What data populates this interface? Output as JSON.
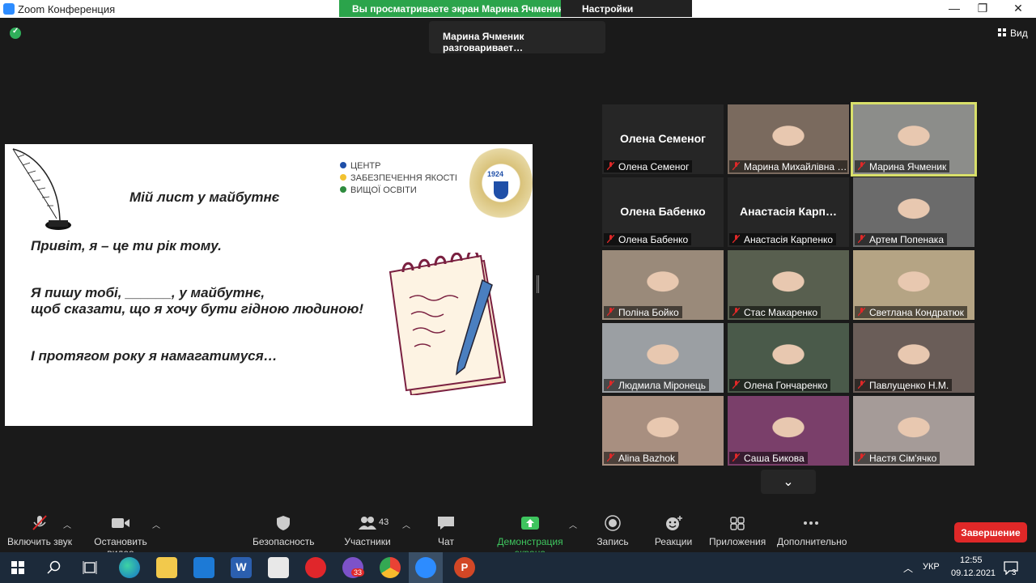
{
  "window": {
    "app_title": "Zoom Конференция",
    "share_banner": "Вы просматриваете экран Марина Ячменик",
    "view_options": "Настройки просмотра"
  },
  "stage": {
    "speaker_chip": "Марина Ячменик разговаривает…",
    "view_button": "Вид"
  },
  "slide": {
    "title": "Мій лист у майбутнє",
    "center_lines": [
      "ЦЕНТР",
      "ЗАБЕЗПЕЧЕННЯ ЯКОСТІ",
      "ВИЩОЇ ОСВІТИ"
    ],
    "line1": "Привіт, я – це ти рік тому.",
    "line2": "Я пишу тобі, ______, у майбутнє,",
    "line3": "щоб сказати, що я хочу бути гідною людиною!",
    "line4": "І протягом року я намагатимуся…",
    "seal_year": "1924",
    "center_dot_colors": [
      "#1f4fa8",
      "#f2c230",
      "#2e8b3e"
    ]
  },
  "participants": [
    {
      "name": "Олена Семеног",
      "big_name": "Олена Семеног",
      "video": false
    },
    {
      "name": "Марина Михайлівна …",
      "big_name": "",
      "video": true,
      "bg": "#7a6a5e"
    },
    {
      "name": "Марина Ячменик",
      "big_name": "",
      "video": true,
      "bg": "#8c8d8a",
      "active": true
    },
    {
      "name": "Олена Бабенко",
      "big_name": "Олена Бабенко",
      "video": false
    },
    {
      "name": "Анастасія Карпенко",
      "big_name": "Анастасія Карп…",
      "video": false
    },
    {
      "name": "Артем Попенака",
      "big_name": "",
      "video": true,
      "bg": "#6b6b6b"
    },
    {
      "name": "Поліна Бойко",
      "big_name": "",
      "video": true,
      "bg": "#9a8a7a"
    },
    {
      "name": "Стас Макаренко",
      "big_name": "",
      "video": true,
      "bg": "#585f4f"
    },
    {
      "name": "Светлана Кондратюк",
      "big_name": "",
      "video": true,
      "bg": "#b5a484"
    },
    {
      "name": "Людмила Міронець",
      "big_name": "",
      "video": true,
      "bg": "#9b9fa3"
    },
    {
      "name": "Олена Гончаренко",
      "big_name": "",
      "video": true,
      "bg": "#4a5a4a"
    },
    {
      "name": "Павлущенко Н.М.",
      "big_name": "",
      "video": true,
      "bg": "#6a5d58"
    },
    {
      "name": "Alina Bazhok",
      "big_name": "",
      "video": true,
      "bg": "#a88f80"
    },
    {
      "name": "Саша Бикова",
      "big_name": "",
      "video": true,
      "bg": "#7a3f6a"
    },
    {
      "name": "Настя Сім'ячко",
      "big_name": "",
      "video": true,
      "bg": "#a59b98"
    }
  ],
  "toolbar": {
    "mute": "Включить звук",
    "video": "Остановить видео",
    "security": "Безопасность",
    "participants": "Участники",
    "participants_count": "43",
    "chat": "Чат",
    "share": "Демонстрация экрана",
    "record": "Запись",
    "reactions": "Реакции",
    "apps": "Приложения",
    "more": "Дополнительно",
    "end": "Завершение"
  },
  "taskbar": {
    "language": "УКР",
    "time": "12:55",
    "date": "09.12.2021",
    "viber_badge": "33",
    "notifications": "3"
  }
}
